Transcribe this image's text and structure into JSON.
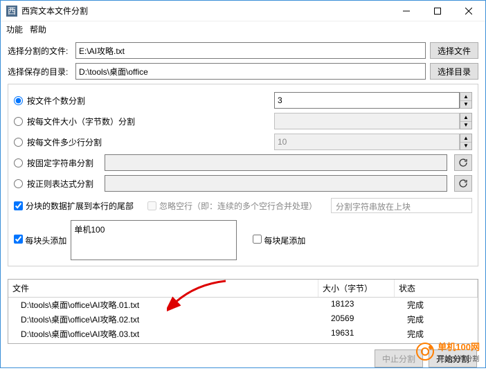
{
  "window": {
    "title": "西宾文本文件分割",
    "menu_func": "功能",
    "menu_help": "帮助"
  },
  "form": {
    "select_file_label": "选择分割的文件:",
    "select_file_value": "E:\\AI攻略.txt",
    "select_file_btn": "选择文件",
    "select_dir_label": "选择保存的目录:",
    "select_dir_value": "D:\\tools\\桌面\\office",
    "select_dir_btn": "选择目录"
  },
  "modes": {
    "by_count": "按文件个数分割",
    "by_count_value": "3",
    "by_bytes": "按每文件大小（字节数）分割",
    "by_bytes_value": "",
    "by_lines": "按每文件多少行分割",
    "by_lines_value": "10",
    "by_fixed": "按固定字符串分割",
    "by_fixed_value": "",
    "by_regex": "按正则表达式分割",
    "by_regex_value": ""
  },
  "opts": {
    "expand_tail": "分块的数据扩展到本行的尾部",
    "skip_blank": "忽略空行（即：连续的多个空行合并处理）",
    "sep_place": "分割字符串放在上块",
    "head_label": "每块头添加",
    "head_text": "单机100",
    "tail_label": "每块尾添加"
  },
  "grid": {
    "col_file": "文件",
    "col_size": "大小（字节）",
    "col_status": "状态",
    "rows": [
      {
        "file": "D:\\tools\\桌面\\office\\AI攻略.01.txt",
        "size": "18123",
        "status": "完成"
      },
      {
        "file": "D:\\tools\\桌面\\office\\AI攻略.02.txt",
        "size": "20569",
        "status": "完成"
      },
      {
        "file": "D:\\tools\\桌面\\office\\AI攻略.03.txt",
        "size": "19631",
        "status": "完成"
      }
    ]
  },
  "buttons": {
    "abort": "中止分割",
    "start": "开始分割"
  },
  "watermark": {
    "text": "单机100网",
    "subtitle": "完成文件分割"
  }
}
